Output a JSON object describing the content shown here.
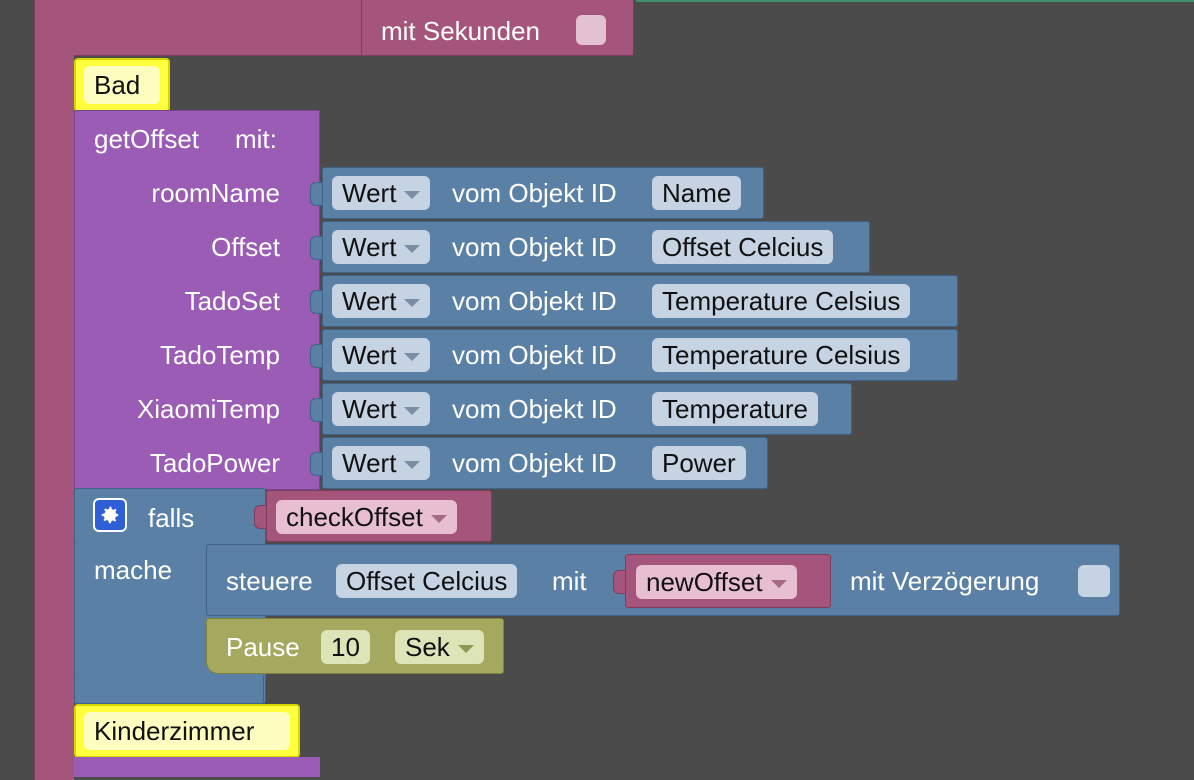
{
  "top_block": {
    "seconds_label": "mit Sekunden"
  },
  "comments": {
    "bad": "Bad",
    "kinderzimmer": "Kinderzimmer"
  },
  "function_call": {
    "name": "getOffset",
    "with_label": "mit:",
    "params": [
      {
        "label": "roomName",
        "dropdown": "Wert",
        "object_label": "vom Objekt ID",
        "object_id": "Name"
      },
      {
        "label": "Offset",
        "dropdown": "Wert",
        "object_label": "vom Objekt ID",
        "object_id": "Offset Celcius"
      },
      {
        "label": "TadoSet",
        "dropdown": "Wert",
        "object_label": "vom Objekt ID",
        "object_id": "Temperature Celsius"
      },
      {
        "label": "TadoTemp",
        "dropdown": "Wert",
        "object_label": "vom Objekt ID",
        "object_id": "Temperature Celsius"
      },
      {
        "label": "XiaomiTemp",
        "dropdown": "Wert",
        "object_label": "vom Objekt ID",
        "object_id": "Temperature"
      },
      {
        "label": "TadoPower",
        "dropdown": "Wert",
        "object_label": "vom Objekt ID",
        "object_id": "Power"
      }
    ]
  },
  "if_block": {
    "if_label": "falls",
    "do_label": "mache",
    "condition": "checkOffset"
  },
  "control_block": {
    "label": "steuere",
    "target": "Offset Celcius",
    "with_label": "mit",
    "value": "newOffset",
    "delay_label": "mit Verzögerung"
  },
  "pause_block": {
    "label": "Pause",
    "value": "10",
    "unit": "Sek"
  },
  "colors": {
    "workspace": "#4b4b4b",
    "procedure": "#a5557b",
    "function": "#9a5cb4",
    "logic": "#5b80a5",
    "timer": "#a5a960",
    "comment": "#ffff3d"
  },
  "icons": [
    "gear-icon",
    "dropdown-caret-icon",
    "checkbox-icon"
  ]
}
